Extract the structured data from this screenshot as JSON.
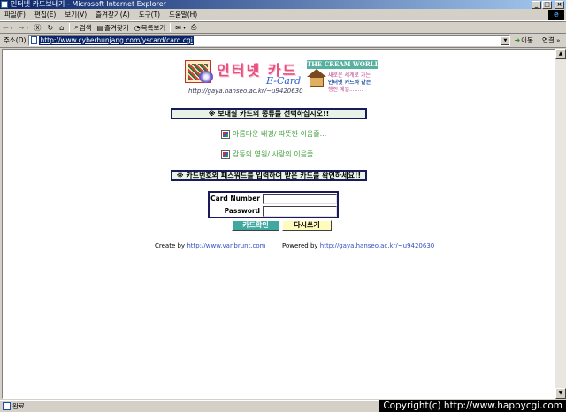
{
  "window": {
    "title": "인터넷 카드보내기 - Microsoft Internet Explorer",
    "minimize_glyph": "_",
    "maximize_glyph": "□",
    "close_glyph": "×"
  },
  "menu": [
    "파일(F)",
    "편집(E)",
    "보기(V)",
    "즐겨찾기(A)",
    "도구(T)",
    "도움말(H)"
  ],
  "toolbar": {
    "back_label": "←",
    "forward_label": "→",
    "stop_label": "Ⓧ",
    "refresh_label": "↻",
    "home_label": "⌂",
    "search_label": "검색",
    "favorites_label": "즐겨찾기",
    "history_label": "목록보기",
    "mail_label": "✉",
    "print_label": "⎙"
  },
  "address": {
    "label": "주소(D)",
    "url": "http://www.cyberhunjang.com/yscard/card.cgi",
    "go_label": "이동",
    "links_label": "연결"
  },
  "page": {
    "banner": {
      "title": "인터넷  카드",
      "subtitle": "E-Card",
      "url": "http://gaya.hanseo.ac.kr/~u9420630",
      "logo_top": "THE CREAM WORLD",
      "logo_line1": "새로운 세계로 가는",
      "logo_line2": "인터넷 카드와 같은",
      "logo_line3": "행진 메일........"
    },
    "select_header": "※ 보내실 카드의 종류를 선택하십시오!!",
    "links": [
      "아름다운 배경/ 따뜻한 이음줄...",
      "감동의 영원/ 사랑의 이음줄..."
    ],
    "confirm_header": "※ 카드번호와 패스워드를 입력하여 받은 카드를 확인하세요!!",
    "login": {
      "card_number_label": "Card Number",
      "password_label": "Password",
      "card_number_value": "",
      "password_value": ""
    },
    "buttons": {
      "confirm": "카드확인",
      "rewrite": "다시쓰기"
    },
    "footer": {
      "create_prefix": "Create by",
      "create_link": "http://www.vanbrunt.com",
      "powered_prefix": "Powered by",
      "powered_link": "http://gaya.hanseo.ac.kr/~u9420630"
    }
  },
  "statusbar": {
    "text": "완료"
  },
  "watermark": "Copyright(c) http://www.happycgi.com"
}
